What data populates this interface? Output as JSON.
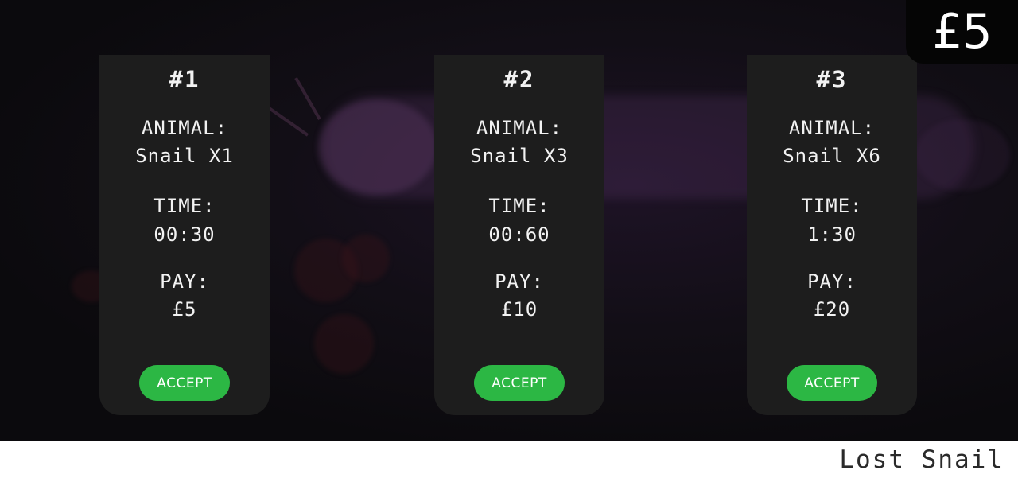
{
  "balance": "£5",
  "contracts": [
    {
      "number": "#1",
      "animal_label": "ANIMAL:",
      "animal": "Snail X1",
      "time_label": "TIME:",
      "time": "00:30",
      "pay_label": "PAY:",
      "pay": "£5",
      "accept_label": "ACCEPT"
    },
    {
      "number": "#2",
      "animal_label": "ANIMAL:",
      "animal": "Snail X3",
      "time_label": "TIME:",
      "time": "00:60",
      "pay_label": "PAY:",
      "pay": "£10",
      "accept_label": "ACCEPT"
    },
    {
      "number": "#3",
      "animal_label": "ANIMAL:",
      "animal": "Snail X6",
      "time_label": "TIME:",
      "time": "1:30",
      "pay_label": "PAY:",
      "pay": "£20",
      "accept_label": "ACCEPT"
    }
  ],
  "footer": {
    "title": "Lost Snail"
  },
  "colors": {
    "card_background": "#1d1d1d",
    "accept_button": "#2cb744",
    "balance_background": "#050505",
    "text": "#f2f2f2"
  }
}
